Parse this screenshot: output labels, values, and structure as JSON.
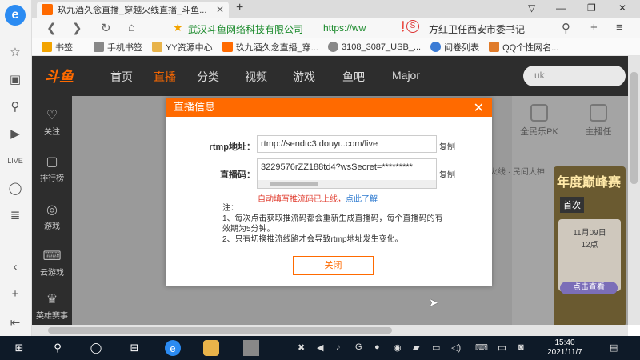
{
  "browser": {
    "tab_title": "玖九酒久念直播_穿越火线直播_斗鱼...",
    "tab_close": "✕",
    "new_tab": "+",
    "site_name": "武汉斗鱼网络科技有限公司",
    "url": "https://ww",
    "suggest_badge": "S",
    "news_ticker": "方红卫任西安市委书记"
  },
  "bookmarks": [
    "书签",
    "手机书签",
    "YY资源中心",
    "玖九酒久念直播_穿...",
    "3108_3087_USB_...",
    "问卷列表",
    "QQ个性网名..."
  ],
  "site_nav": {
    "logo": "斗鱼",
    "items": [
      "首页",
      "直播",
      "分类",
      "视频",
      "游戏",
      "鱼吧",
      "Major"
    ],
    "active_index": 1,
    "search_placeholder": "uk"
  },
  "site_side": [
    "关注",
    "排行榜",
    "游戏",
    "云游戏",
    "英雄赛事"
  ],
  "right_panel": {
    "pk_label": "全民乐PK",
    "host_label": "主播任",
    "crumb": "火线 · 民间大神",
    "promo_title": "年度巅峰赛",
    "promo_tag": "首次",
    "promo_date": "11月09日",
    "promo_time": "12点",
    "promo_btn": "点击查看"
  },
  "modal": {
    "title": "直播信息",
    "close_icon": "✕",
    "rtmp_label": "rtmp地址：",
    "rtmp_value": "rtmp://sendtc3.douyu.com/live",
    "code_label": "直播码：",
    "code_value": "3229576rZZ188td4?wsSecret=*********",
    "copy_label": "复制",
    "warning_text": "自动填写推流码已上线，",
    "warning_link": "点此了解",
    "notes_title": "注：",
    "note1": "1、每次点击获取推流码都会重新生成直播码，每个直播码的有效期为5分钟。",
    "note2": "2、只有切换推流线路才会导致rtmp地址发生变化。",
    "close_btn": "关闭"
  },
  "taskbar": {
    "time": "15:40",
    "date": "2021/11/7",
    "ime": "中"
  }
}
